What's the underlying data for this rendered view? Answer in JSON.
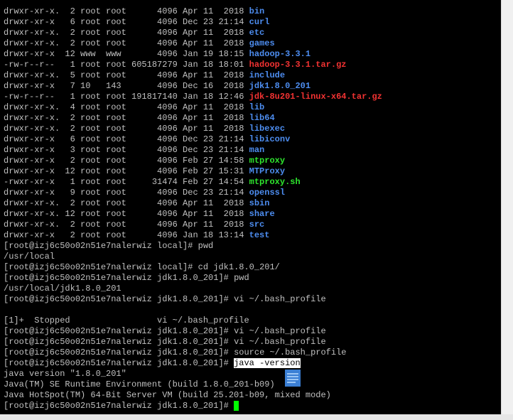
{
  "terminal": {
    "listing": [
      {
        "perms": "drwxr-xr-x.",
        "links": "2",
        "user": "root",
        "group": "root",
        "size": "4096",
        "month": "Apr",
        "day": "11",
        "time": "2018",
        "name": "bin",
        "kind": "dir"
      },
      {
        "perms": "drwxr-xr-x",
        "links": "6",
        "user": "root",
        "group": "root",
        "size": "4096",
        "month": "Dec",
        "day": "23",
        "time": "21:14",
        "name": "curl",
        "kind": "dir"
      },
      {
        "perms": "drwxr-xr-x.",
        "links": "2",
        "user": "root",
        "group": "root",
        "size": "4096",
        "month": "Apr",
        "day": "11",
        "time": "2018",
        "name": "etc",
        "kind": "dir"
      },
      {
        "perms": "drwxr-xr-x.",
        "links": "2",
        "user": "root",
        "group": "root",
        "size": "4096",
        "month": "Apr",
        "day": "11",
        "time": "2018",
        "name": "games",
        "kind": "dir"
      },
      {
        "perms": "drwxr-xr-x",
        "links": "12",
        "user": "www",
        "group": "www",
        "size": "4096",
        "month": "Jan",
        "day": "19",
        "time": "18:15",
        "name": "hadoop-3.3.1",
        "kind": "dir"
      },
      {
        "perms": "-rw-r--r--",
        "links": "1",
        "user": "root",
        "group": "root",
        "size": "605187279",
        "month": "Jan",
        "day": "18",
        "time": "18:01",
        "name": "hadoop-3.3.1.tar.gz",
        "kind": "arc"
      },
      {
        "perms": "drwxr-xr-x.",
        "links": "5",
        "user": "root",
        "group": "root",
        "size": "4096",
        "month": "Apr",
        "day": "11",
        "time": "2018",
        "name": "include",
        "kind": "dir"
      },
      {
        "perms": "drwxr-xr-x",
        "links": "7",
        "user": "10",
        "group": "143",
        "size": "4096",
        "month": "Dec",
        "day": "16",
        "time": "2018",
        "name": "jdk1.8.0_201",
        "kind": "dir"
      },
      {
        "perms": "-rw-r--r--",
        "links": "1",
        "user": "root",
        "group": "root",
        "size": "191817140",
        "month": "Jan",
        "day": "18",
        "time": "12:46",
        "name": "jdk-8u201-linux-x64.tar.gz",
        "kind": "arc"
      },
      {
        "perms": "drwxr-xr-x.",
        "links": "4",
        "user": "root",
        "group": "root",
        "size": "4096",
        "month": "Apr",
        "day": "11",
        "time": "2018",
        "name": "lib",
        "kind": "dir"
      },
      {
        "perms": "drwxr-xr-x.",
        "links": "2",
        "user": "root",
        "group": "root",
        "size": "4096",
        "month": "Apr",
        "day": "11",
        "time": "2018",
        "name": "lib64",
        "kind": "dir"
      },
      {
        "perms": "drwxr-xr-x.",
        "links": "2",
        "user": "root",
        "group": "root",
        "size": "4096",
        "month": "Apr",
        "day": "11",
        "time": "2018",
        "name": "libexec",
        "kind": "dir"
      },
      {
        "perms": "drwxr-xr-x",
        "links": "6",
        "user": "root",
        "group": "root",
        "size": "4096",
        "month": "Dec",
        "day": "23",
        "time": "21:14",
        "name": "libiconv",
        "kind": "dir"
      },
      {
        "perms": "drwxr-xr-x",
        "links": "3",
        "user": "root",
        "group": "root",
        "size": "4096",
        "month": "Dec",
        "day": "23",
        "time": "21:14",
        "name": "man",
        "kind": "dir"
      },
      {
        "perms": "drwxr-xr-x",
        "links": "2",
        "user": "root",
        "group": "root",
        "size": "4096",
        "month": "Feb",
        "day": "27",
        "time": "14:58",
        "name": "mtproxy",
        "kind": "exe"
      },
      {
        "perms": "drwxr-xr-x",
        "links": "12",
        "user": "root",
        "group": "root",
        "size": "4096",
        "month": "Feb",
        "day": "27",
        "time": "15:31",
        "name": "MTProxy",
        "kind": "dir"
      },
      {
        "perms": "-rwxr-xr-x",
        "links": "1",
        "user": "root",
        "group": "root",
        "size": "31474",
        "month": "Feb",
        "day": "27",
        "time": "14:54",
        "name": "mtproxy.sh",
        "kind": "exe"
      },
      {
        "perms": "drwxr-xr-x",
        "links": "9",
        "user": "root",
        "group": "root",
        "size": "4096",
        "month": "Dec",
        "day": "23",
        "time": "21:14",
        "name": "openssl",
        "kind": "dir"
      },
      {
        "perms": "drwxr-xr-x.",
        "links": "2",
        "user": "root",
        "group": "root",
        "size": "4096",
        "month": "Apr",
        "day": "11",
        "time": "2018",
        "name": "sbin",
        "kind": "dir"
      },
      {
        "perms": "drwxr-xr-x.",
        "links": "12",
        "user": "root",
        "group": "root",
        "size": "4096",
        "month": "Apr",
        "day": "11",
        "time": "2018",
        "name": "share",
        "kind": "dir"
      },
      {
        "perms": "drwxr-xr-x.",
        "links": "2",
        "user": "root",
        "group": "root",
        "size": "4096",
        "month": "Apr",
        "day": "11",
        "time": "2018",
        "name": "src",
        "kind": "dir"
      },
      {
        "perms": "drwxr-xr-x",
        "links": "2",
        "user": "root",
        "group": "root",
        "size": "4096",
        "month": "Jan",
        "day": "18",
        "time": "13:14",
        "name": "test",
        "kind": "dir"
      }
    ],
    "session": [
      {
        "prompt": "[root@izj6c50o02n51e7nalerwiz local]# ",
        "text": "pwd"
      },
      {
        "prompt": "",
        "text": "/usr/local"
      },
      {
        "prompt": "[root@izj6c50o02n51e7nalerwiz local]# ",
        "text": "cd jdk1.8.0_201/"
      },
      {
        "prompt": "[root@izj6c50o02n51e7nalerwiz jdk1.8.0_201]# ",
        "text": "pwd"
      },
      {
        "prompt": "",
        "text": "/usr/local/jdk1.8.0_201"
      },
      {
        "prompt": "[root@izj6c50o02n51e7nalerwiz jdk1.8.0_201]# ",
        "text": "vi ~/.bash_profile"
      },
      {
        "prompt": "",
        "text": ""
      },
      {
        "prompt": "",
        "text": "[1]+  Stopped                 vi ~/.bash_profile"
      },
      {
        "prompt": "[root@izj6c50o02n51e7nalerwiz jdk1.8.0_201]# ",
        "text": "vi ~/.bash_profile"
      },
      {
        "prompt": "[root@izj6c50o02n51e7nalerwiz jdk1.8.0_201]# ",
        "text": "vi ~/.bash_profile"
      },
      {
        "prompt": "[root@izj6c50o02n51e7nalerwiz jdk1.8.0_201]# ",
        "text": "source ~/.bash_profile"
      },
      {
        "prompt": "[root@izj6c50o02n51e7nalerwiz jdk1.8.0_201]# ",
        "text": "java -version",
        "selected": true
      },
      {
        "prompt": "",
        "text": "java version \"1.8.0_201\""
      },
      {
        "prompt": "",
        "text": "Java(TM) SE Runtime Environment (build 1.8.0_201-b09)"
      },
      {
        "prompt": "",
        "text": "Java HotSpot(TM) 64-Bit Server VM (build 25.201-b09, mixed mode)"
      },
      {
        "prompt": "[root@izj6c50o02n51e7nalerwiz jdk1.8.0_201]# ",
        "text": "",
        "cursor": true
      }
    ]
  },
  "colors": {
    "background": "#000000",
    "text": "#c0c0c0",
    "directory": "#4d8df0",
    "archive": "#f23232",
    "executable": "#2ee62e",
    "cursor": "#00ff00",
    "selection_bg": "#ffffff"
  },
  "icons": {
    "overlay": "document-icon"
  }
}
